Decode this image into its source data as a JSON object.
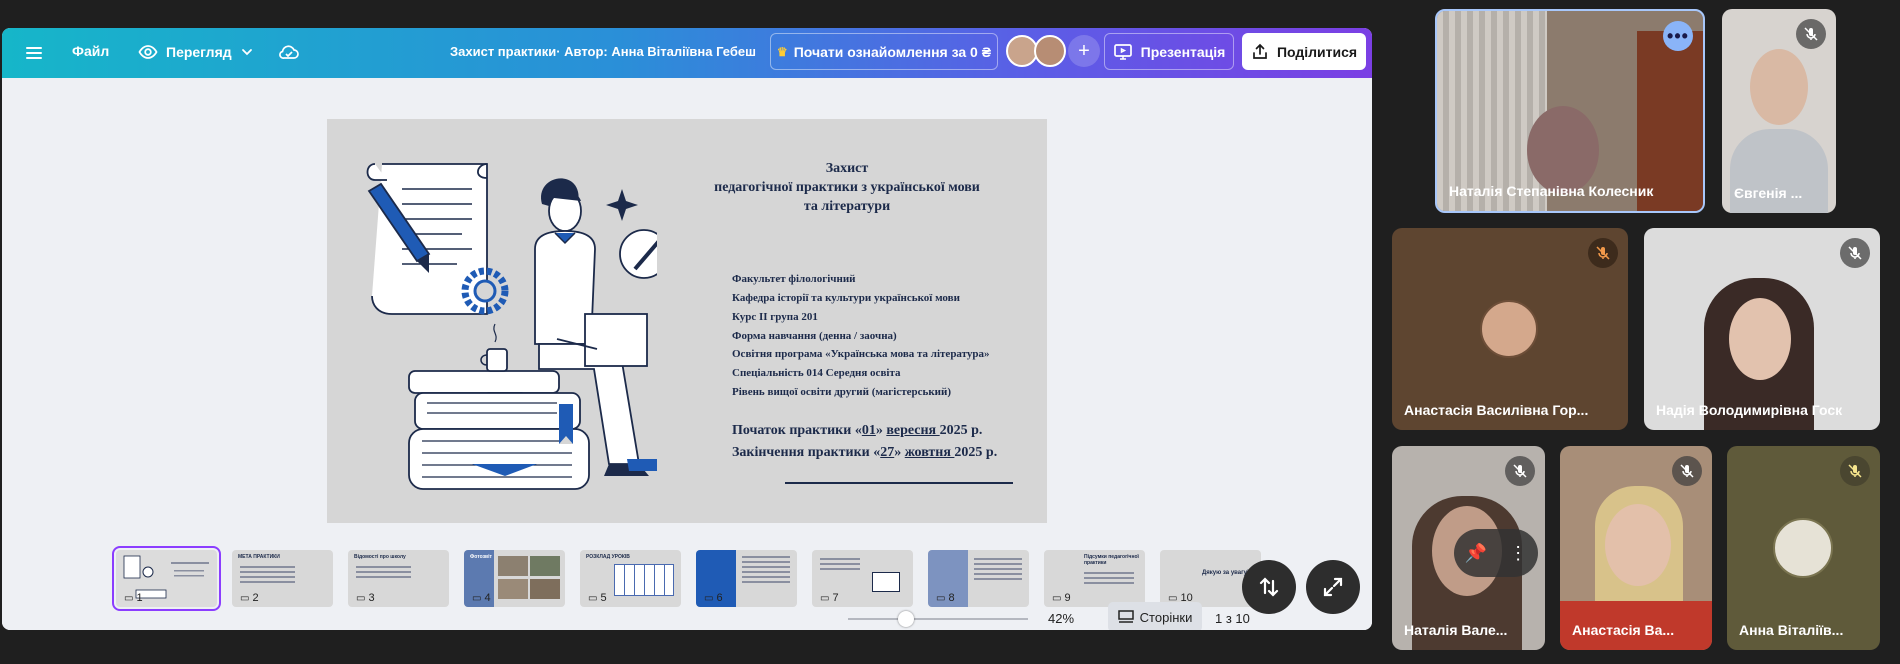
{
  "topbar": {
    "file_label": "Файл",
    "view_label": "Перегляд",
    "doc_title": "Захист практики· Автор: Анна Віталіївна Гебеш",
    "trial_label": "Почати ознайомлення за 0 ₴",
    "present_label": "Презентація",
    "share_label": "Поділитися"
  },
  "slide": {
    "title_line1": "Захист",
    "title_line2": "педагогічної практики з української мови",
    "title_line3": "та літератури",
    "info": [
      "Факультет філологічний",
      "Кафедра історії та культури української мови",
      "Курс ІІ група 201",
      "Форма навчання (денна / заочна)",
      "Освітня програма «Українська мова та література»",
      "Спеціальність 014 Середня освіта",
      "Рівень вищої освіти  другий (магістерський)"
    ],
    "start_prefix": "Початок практики  «",
    "start_day": "01",
    "start_mid": "» ",
    "start_month": "вересня ",
    "start_year": "2025 р.",
    "end_prefix": "Закінчення практики «",
    "end_day": "27",
    "end_mid": "» ",
    "end_month": "жовтня ",
    "end_year": "2025 р."
  },
  "thumbnails": [
    {
      "num": "1",
      "title": ""
    },
    {
      "num": "2",
      "title": "МЕТА ПРАКТИКИ"
    },
    {
      "num": "3",
      "title": "Відомості про школу"
    },
    {
      "num": "4",
      "title": "Фотозвіт"
    },
    {
      "num": "5",
      "title": "РОЗКЛАД УРОКІВ"
    },
    {
      "num": "6",
      "title": ""
    },
    {
      "num": "7",
      "title": ""
    },
    {
      "num": "8",
      "title": ""
    },
    {
      "num": "9",
      "title": "Підсумки педагогічної практики"
    },
    {
      "num": "10",
      "title": "Дякую за увагу!"
    }
  ],
  "bottombar": {
    "zoom_value": 0.42,
    "zoom_label": "42%",
    "pages_label": "Сторінки",
    "page_counter": "1 з 10"
  },
  "participants": [
    {
      "name": "Наталія Степанівна Колесник",
      "muted": false
    },
    {
      "name": "Євгенія ...",
      "muted": true
    },
    {
      "name": "Анастасія Василівна Гор...",
      "muted": true
    },
    {
      "name": "Надія Володимирівна Госк",
      "muted": true
    },
    {
      "name": "Наталія Вале...",
      "muted": true
    },
    {
      "name": "Анастасія Ва...",
      "muted": true
    },
    {
      "name": "Анна Віталіїв...",
      "muted": true
    }
  ],
  "colors": {
    "accent_purple": "#8b3dff",
    "slide_navy": "#1c2a4a",
    "slide_blue": "#1f5bb5"
  },
  "icons": {
    "menu": "menu-icon",
    "view": "eye-icon",
    "cloud": "cloud-sync-icon",
    "crown": "crown-icon",
    "present": "present-icon",
    "share": "share-icon",
    "mic_off": "mic-off-icon",
    "more": "more-options-icon"
  }
}
